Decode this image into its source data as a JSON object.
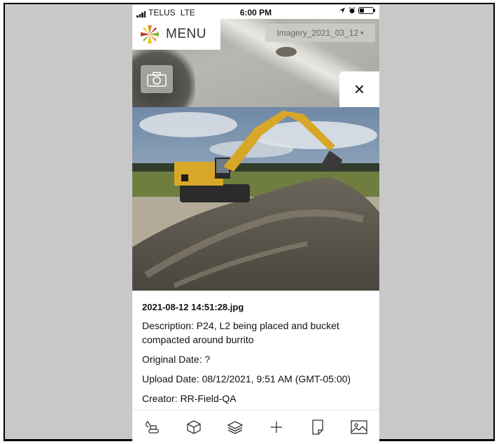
{
  "status_bar": {
    "carrier": "TELUS",
    "network": "LTE",
    "time": "6:00 PM",
    "battery_level": 0.35
  },
  "header": {
    "menu_label": "MENU",
    "logo_icon": "star-logo-icon",
    "imagery_selector": "Imagery_2021_03_12",
    "imagery_caret": "▾"
  },
  "map_controls": {
    "camera_icon": "camera-icon",
    "close_label": "×"
  },
  "photo": {
    "subject": "excavator-photo"
  },
  "details": {
    "filename": "2021-08-12 14:51:28.jpg",
    "description": "Description: P24, L2 being placed and bucket compacted around burrito",
    "original_date": "Original Date: ?",
    "upload_date": "Upload Date: 08/12/2021, 9:51 AM (GMT-05:00)",
    "creator": "Creator: RR-Field-QA"
  },
  "toolbar": {
    "tools": [
      "excavator-icon",
      "cube-icon",
      "layers-icon",
      "measure-icon",
      "document-icon",
      "image-icon"
    ]
  },
  "colors": {
    "logo_orange": "#e8892b",
    "logo_green": "#8fae3a",
    "logo_red": "#c0392b",
    "logo_yellow": "#f0c419",
    "excavator_yellow": "#d8a72a"
  }
}
